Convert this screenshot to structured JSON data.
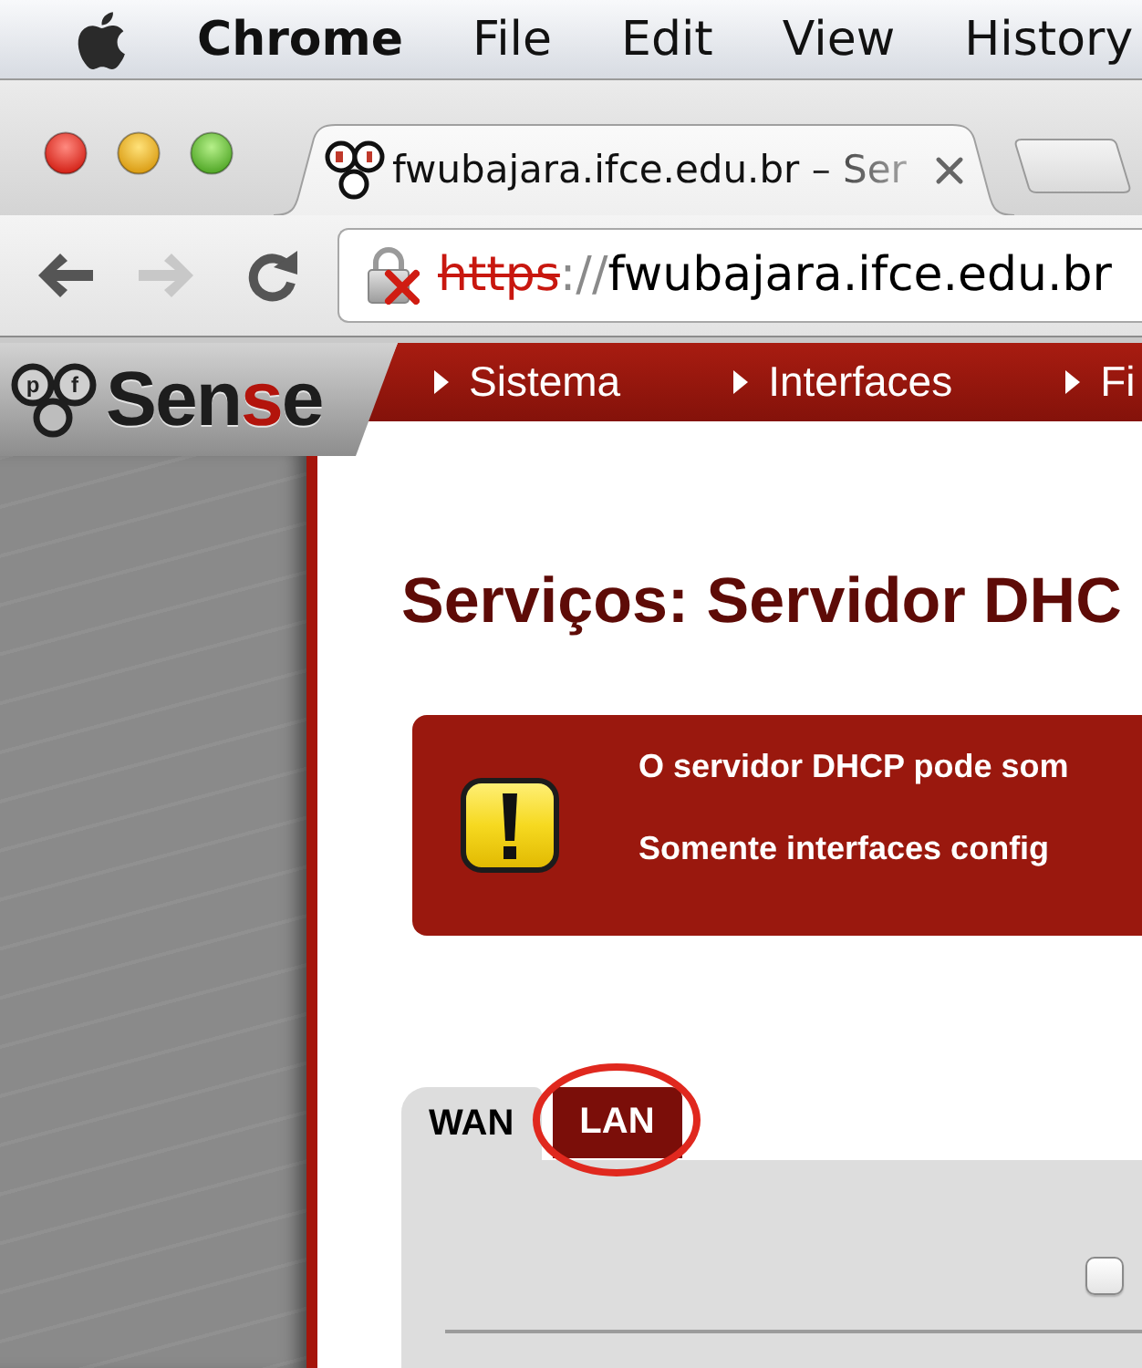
{
  "menu_bar": {
    "app_name": "Chrome",
    "items": [
      "File",
      "Edit",
      "View",
      "History"
    ]
  },
  "browser": {
    "tab": {
      "title": "fwubajara.ifce.edu.br – Ser"
    },
    "navigation": {
      "back_enabled": true,
      "forward_enabled": false
    },
    "address": {
      "scheme": "https",
      "separator": "://",
      "host": "fwubajara.ifce.edu.br",
      "certificate_error": true
    }
  },
  "header": {
    "logo": {
      "mark_letters": [
        "p",
        "f"
      ],
      "wordmark": [
        {
          "text": "Sen",
          "accent": false
        },
        {
          "text": "s",
          "accent": true
        },
        {
          "text": "e",
          "accent": false
        }
      ]
    },
    "nav_items": [
      "Sistema",
      "Interfaces",
      "Fi"
    ]
  },
  "page_title": "Serviços: Servidor DHC",
  "alert": {
    "lines": [
      "O servidor DHCP pode som",
      "Somente interfaces config"
    ]
  },
  "interface_tabs": [
    {
      "label": "WAN",
      "selected": true,
      "circled": false
    },
    {
      "label": "LAN",
      "selected": false,
      "circled": true
    }
  ],
  "panel": {
    "checkbox": {
      "checked": false
    }
  }
}
